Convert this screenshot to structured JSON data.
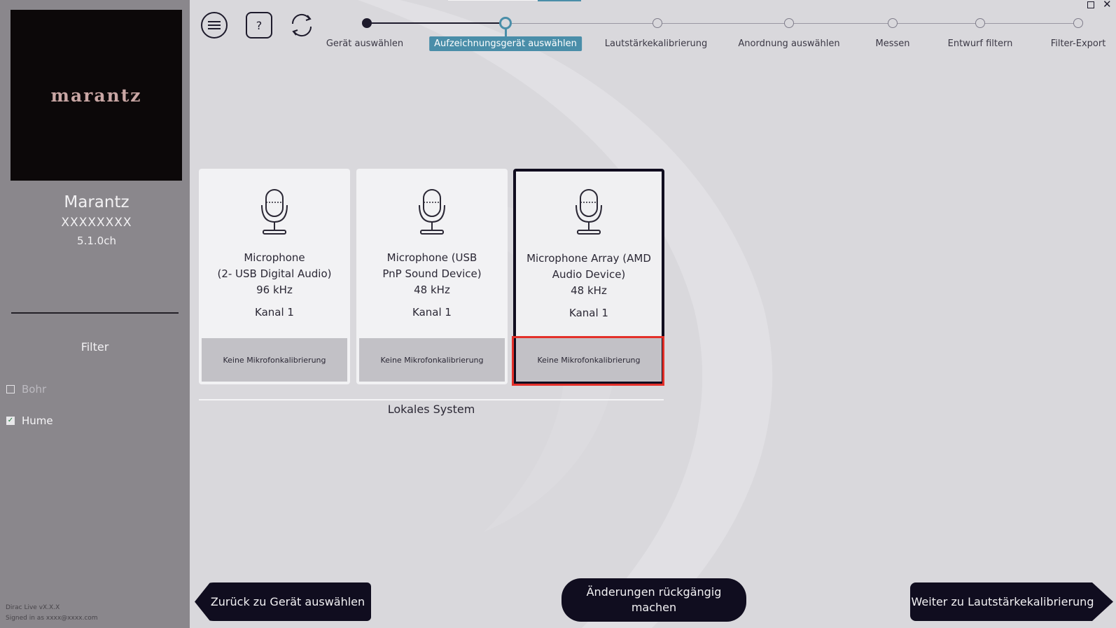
{
  "sidebar": {
    "logo_text": "marantz",
    "device_name": "Marantz",
    "device_model": "XXXXXXXX",
    "channels": "5.1.0ch",
    "filter_title": "Filter",
    "filters": [
      {
        "label": "Bohr",
        "checked": false
      },
      {
        "label": "Hume",
        "checked": true
      }
    ],
    "version": "Dirac Live vX.X.X",
    "signed_in": "Signed in as xxxx@xxxx.com"
  },
  "toolbar": {
    "menu_icon": "hamburger-menu-icon",
    "help_label": "?",
    "refresh_icon": "refresh-icon"
  },
  "stepper": {
    "steps": [
      {
        "label": "Gerät auswählen",
        "state": "done"
      },
      {
        "label": "Aufzeichnungsgerät auswählen",
        "state": "active"
      },
      {
        "label": "Lautstärkekalibrierung",
        "state": "pending"
      },
      {
        "label": "Anordnung auswählen",
        "state": "pending"
      },
      {
        "label": "Messen",
        "state": "pending"
      },
      {
        "label": "Entwurf filtern",
        "state": "pending"
      },
      {
        "label": "Filter-Export",
        "state": "pending"
      }
    ],
    "accent_color": "#4a8ea9"
  },
  "devices": [
    {
      "name_line1": "Microphone",
      "name_line2": "(2- USB Digital Audio)",
      "rate": "96 kHz",
      "channel": "Kanal 1",
      "calibration": "Keine Mikrofonkalibrierung",
      "selected": false
    },
    {
      "name_line1": "Microphone (USB",
      "name_line2": "PnP Sound Device)",
      "rate": "48 kHz",
      "channel": "Kanal 1",
      "calibration": "Keine Mikrofonkalibrierung",
      "selected": false
    },
    {
      "name_line1": "Microphone Array (AMD",
      "name_line2": "Audio Device)",
      "rate": "48 kHz",
      "channel": "Kanal 1",
      "calibration": "Keine Mikrofonkalibrierung",
      "selected": true
    }
  ],
  "system_label": "Lokales System",
  "buttons": {
    "back": "Zurück zu Gerät auswählen",
    "undo_line1": "Änderungen rückgängig",
    "undo_line2": "machen",
    "next": "Weiter zu Lautstärkekalibrierung"
  },
  "colors": {
    "highlight": "#e3302a",
    "dark": "#100d1f"
  }
}
